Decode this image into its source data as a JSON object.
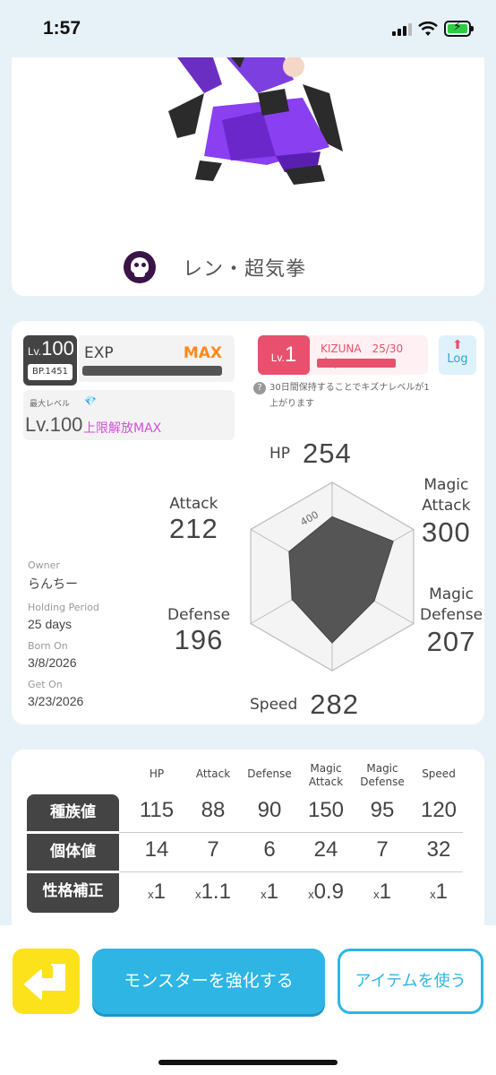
{
  "status": {
    "time": "1:57"
  },
  "monster": {
    "name": "レン・超気拳"
  },
  "level": {
    "lv_prefix": "Lv.",
    "lv": "100",
    "bp": "BP.1451",
    "exp_label": "EXP",
    "exp_value": "MAX"
  },
  "max_level": {
    "caption": "最大レベル",
    "lv": "Lv.100",
    "unlock_text": "上限解放MAX"
  },
  "kizuna": {
    "lv_prefix": "Lv.",
    "lv": "1",
    "text": "KIZUNA　25/30 days",
    "progress": 0.83,
    "log_label": "Log",
    "note": "30日間保持することでキズナレベルが1上がります"
  },
  "stats": {
    "hp": {
      "label": "HP",
      "value": "254"
    },
    "attack": {
      "label": "Attack",
      "value": "212"
    },
    "magic_attack": {
      "label": "Magic\nAttack",
      "value": "300"
    },
    "defense": {
      "label": "Defense",
      "value": "196"
    },
    "magic_defense": {
      "label": "Magic\nDefense",
      "value": "207"
    },
    "speed": {
      "label": "Speed",
      "value": "282"
    },
    "radar_max_label": "400",
    "radar_max": 400
  },
  "owner_info": {
    "owner_label": "Owner",
    "owner": "らんちー",
    "holding_label": "Holding Period",
    "holding": "25 days",
    "born_label": "Born On",
    "born": "3/8/2026",
    "get_label": "Get On",
    "get": "3/23/2026"
  },
  "table": {
    "headers": [
      "HP",
      "Attack",
      "Defense",
      "Magic\nAttack",
      "Magic\nDefense",
      "Speed"
    ],
    "rows": [
      {
        "label": "種族値",
        "values": [
          "115",
          "88",
          "90",
          "150",
          "95",
          "120"
        ]
      },
      {
        "label": "個体値",
        "values": [
          "14",
          "7",
          "6",
          "24",
          "7",
          "32"
        ]
      },
      {
        "label": "性格補正",
        "values": [
          "x1",
          "x1.1",
          "x1",
          "x0.9",
          "x1",
          "x1"
        ]
      }
    ]
  },
  "buttons": {
    "enhance": "モンスターを強化する",
    "use_item": "アイテムを使う"
  }
}
